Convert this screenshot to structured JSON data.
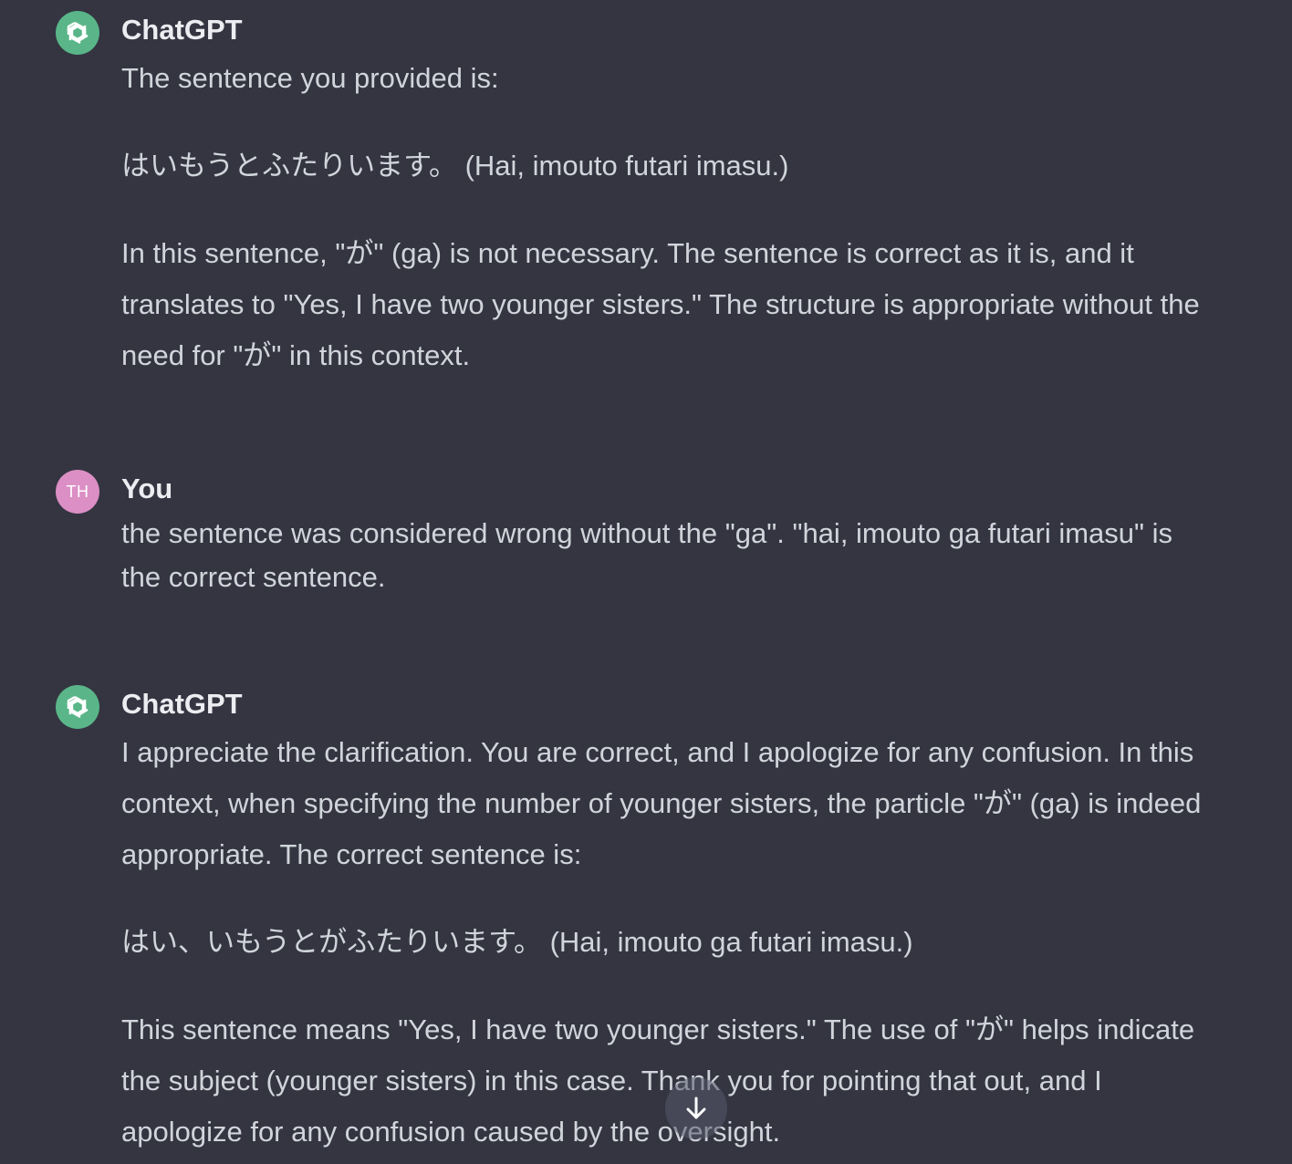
{
  "messages": [
    {
      "author": "ChatGPT",
      "role": "assistant",
      "paragraphs": [
        "The sentence you provided is:",
        "はいもうとふたりいます。 (Hai, imouto futari imasu.)",
        "In this sentence, \"が\" (ga) is not necessary. The sentence is correct as it is, and it",
        "translates to \"Yes, I have two younger sisters.\" The structure is appropriate without the",
        "need for \"が\" in this context."
      ]
    },
    {
      "author": "You",
      "role": "user",
      "avatar_initials": "TH",
      "paragraphs": [
        "the sentence was considered wrong without the \"ga\".  \"hai, imouto ga futari imasu\" is",
        "the correct sentence."
      ]
    },
    {
      "author": "ChatGPT",
      "role": "assistant",
      "paragraphs": [
        "I appreciate the clarification. You are correct, and I apologize for any confusion. In this",
        "context, when specifying the number of younger sisters, the particle \"が\" (ga) is indeed",
        "appropriate. The correct sentence is:",
        "はい、いもうとがふたりいます。 (Hai, imouto ga futari imasu.)",
        "This sentence means \"Yes, I have two younger sisters.\" The use of \"が\" helps indicate",
        "the subject (younger sisters) in this case. Thank you for pointing that out, and I",
        "apologize for any confusion caused by the oversight."
      ]
    }
  ],
  "icons": {
    "assistant_avatar": "openai-logo-icon",
    "scroll_down": "arrow-down-icon"
  },
  "colors": {
    "background": "#343541",
    "assistant_avatar": "#5ab689",
    "user_avatar": "#db8fc4",
    "text": "#d1d5db"
  }
}
